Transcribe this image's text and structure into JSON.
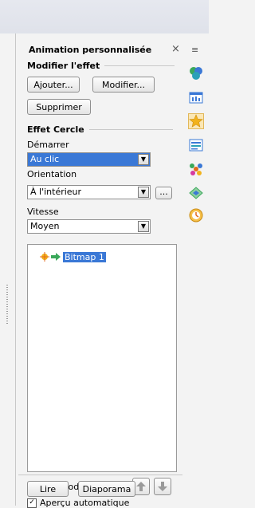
{
  "panel": {
    "title": "Animation personnalisée",
    "close_symbol": "×",
    "modify_section": "Modifier l'effet",
    "add_button": "Ajouter...",
    "modify_button": "Modifier...",
    "remove_button": "Supprimer",
    "effect_section": "Effet Cercle",
    "start_label": "Démarrer",
    "start_value": "Au clic",
    "orientation_label": "Orientation",
    "orientation_value": "À l'intérieur",
    "options_button": "...",
    "speed_label": "Vitesse",
    "speed_value": "Moyen",
    "effects_list": [
      {
        "label": "Bitmap 1"
      }
    ],
    "change_order_label": "Modifier l'ordre :",
    "play_button": "Lire",
    "slideshow_button": "Diaporama",
    "auto_preview_label": "Aperçu automatique",
    "auto_preview_checked": true
  },
  "sidebar": {
    "menu_symbol": "≡",
    "icons": [
      "properties-icon",
      "gallery-icon",
      "slide-layout-icon",
      "custom-animation-icon",
      "slide-transition-icon",
      "styles-icon",
      "navigator-icon",
      "clock-icon"
    ]
  },
  "colors": {
    "selection": "#3a78d6",
    "star": "#f2b21b"
  }
}
